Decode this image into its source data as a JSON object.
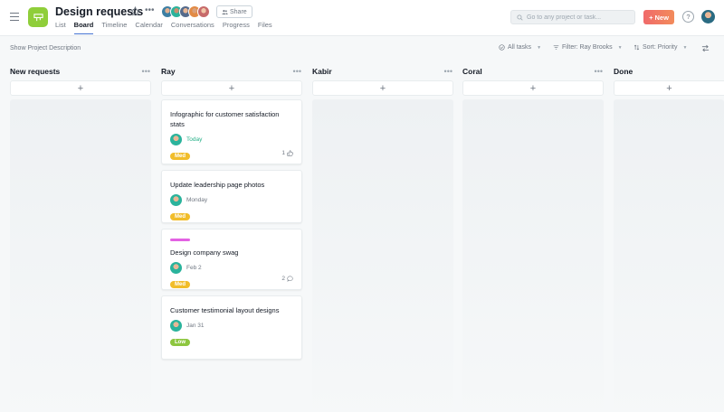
{
  "header": {
    "title": "Design requests",
    "share_label": "Share",
    "tabs": [
      {
        "label": "List"
      },
      {
        "label": "Board",
        "active": true
      },
      {
        "label": "Timeline"
      },
      {
        "label": "Calendar"
      },
      {
        "label": "Conversations"
      },
      {
        "label": "Progress"
      },
      {
        "label": "Files"
      }
    ],
    "search_placeholder": "Go to any project or task...",
    "new_label": "New",
    "help_label": "?"
  },
  "toolbar": {
    "show_description": "Show Project Description",
    "all_tasks": "All tasks",
    "filter": "Filter: Ray Brooks",
    "sort": "Sort: Priority"
  },
  "colors": {
    "accent": "#4573d2",
    "project_icon": "#8fce3a",
    "new_button": "#f06a6a",
    "badge_med": "#f1bd2a",
    "badge_low": "#8dc63f",
    "today": "#25b087",
    "strip": "#e362e3"
  },
  "icons": {
    "menu": "hamburger-icon",
    "project": "board-icon",
    "favorite": "star-icon",
    "share": "people-icon",
    "search": "search-icon",
    "check": "check-circle-icon",
    "filter": "filter-icon",
    "sort": "sort-icon",
    "customize": "swap-arrows-icon",
    "like": "thumbs-up-icon",
    "comment": "comment-icon"
  },
  "columns": [
    {
      "title": "New requests",
      "cards": []
    },
    {
      "title": "Ray",
      "cards": [
        {
          "title": "Infographic for customer satisfaction stats",
          "date": "Today",
          "priority": "Med",
          "stat": "1",
          "stat_icon": "thumbs-up-icon"
        },
        {
          "title": "Update leadership page photos",
          "date": "Monday",
          "priority": "Med"
        },
        {
          "title": "Design company swag",
          "date": "Feb 2",
          "priority": "Med",
          "stat": "2",
          "stat_icon": "comment-icon",
          "strip": true
        },
        {
          "title": "Customer testimonial layout designs",
          "date": "Jan 31",
          "priority": "Low"
        }
      ]
    },
    {
      "title": "Kabir",
      "cards": []
    },
    {
      "title": "Coral",
      "cards": []
    },
    {
      "title": "Done",
      "cards": []
    }
  ]
}
